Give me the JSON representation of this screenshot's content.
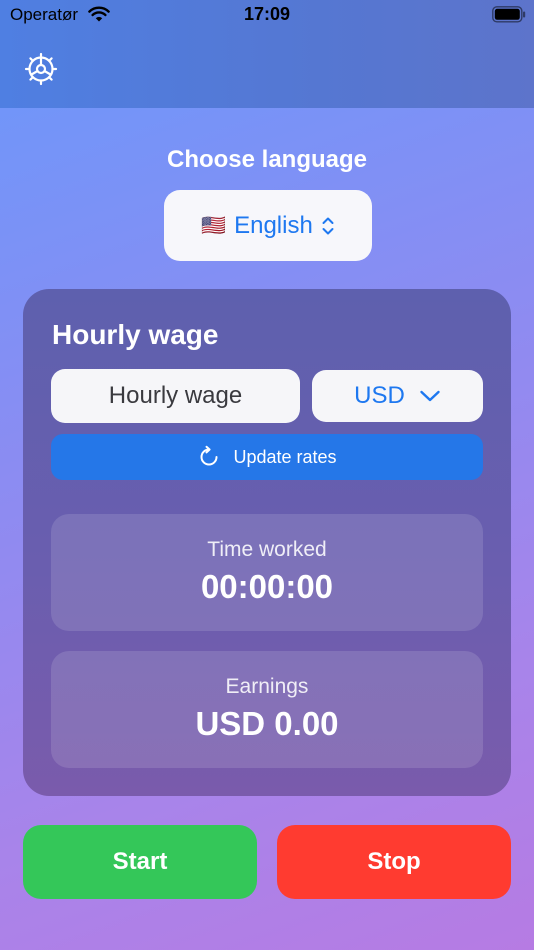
{
  "status_bar": {
    "carrier": "Operatør",
    "time": "17:09"
  },
  "toolbar": {
    "settings_icon": "gear-icon"
  },
  "language": {
    "title": "Choose language",
    "flag": "🇺🇸",
    "selected": "English"
  },
  "wage_card": {
    "title": "Hourly wage",
    "input_value": "",
    "input_placeholder": "Hourly wage",
    "currency": "USD",
    "update_label": "Update rates"
  },
  "stats": {
    "time_label": "Time worked",
    "time_value": "00:00:00",
    "earnings_label": "Earnings",
    "earnings_value": "USD 0.00"
  },
  "actions": {
    "start_label": "Start",
    "stop_label": "Stop"
  },
  "colors": {
    "accent_blue": "#1E78F0",
    "update_button": "#2577E8",
    "start_green": "#34C759",
    "stop_red": "#FF3B30"
  }
}
